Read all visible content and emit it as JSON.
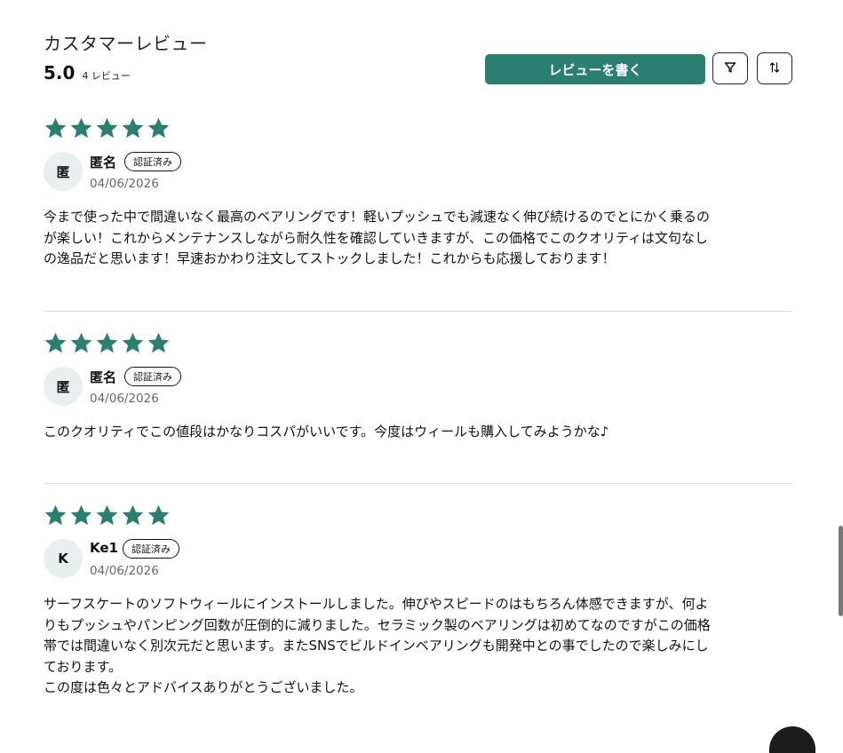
{
  "header": {
    "title": "カスタマーレビュー",
    "average": "5.0",
    "count_label": "4 レビュー",
    "write_review_label": "レビューを書く",
    "filter_icon": "filter-icon",
    "sort_icon": "sort-icon"
  },
  "colors": {
    "accent": "#2a7f70",
    "star": "#2a7f70",
    "divider": "#d9d9d9"
  },
  "reviews": [
    {
      "rating": 5,
      "initial": "匿",
      "name": "匿名",
      "badge": "認証済み",
      "date": "04/06/2026",
      "text": "今まで使った中で間違いなく最高のベアリングです！軽いプッシュでも減速なく伸び続けるのでとにかく乗るの\nが楽しい！これからメンテナンスしながら耐久性を確認していきますが、この価格でこのクオリティは文句なし\nの逸品だと思います！早速おかわり注文してストックしました！これからも応援しております！"
    },
    {
      "rating": 5,
      "initial": "匿",
      "name": "匿名",
      "badge": "認証済み",
      "date": "04/06/2026",
      "text": "このクオリティでこの値段はかなりコスパがいいです。今度はウィールも購入してみようかな♪"
    },
    {
      "rating": 5,
      "initial": "K",
      "name": "Ke1",
      "badge": "認証済み",
      "date": "04/06/2026",
      "text": "サーフスケートのソフトウィールにインストールしました。伸びやスピードのはもちろん体感できますが、何よ\nりもプッシュやパンピング回数が圧倒的に減りました。セラミック製のベアリングは初めてなのですがこの価格\n帯では間違いなく別次元だと思います。またSNSでビルドインベアリングも開発中との事でしたので楽しみにし\nております。\nこの度は色々とアドバイスありがとうございました。"
    }
  ]
}
